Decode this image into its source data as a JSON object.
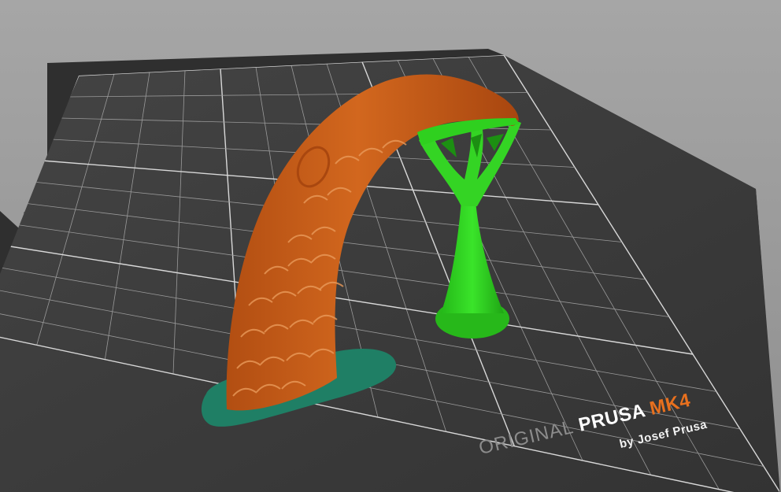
{
  "bed": {
    "logo_prefix": "ORIGINAL",
    "logo_brand": "PRUSA",
    "logo_model": "MK4",
    "logo_subtitle": "by Josef Prusa"
  },
  "colors": {
    "background": "#9e9e9e",
    "bed_surface": "#3a3a3a",
    "bed_frame": "#2f2f2f",
    "grid_line": "#cfcfcf",
    "model_body": "#c85a17",
    "model_brim": "#1f7f65",
    "support": "#2ed01e",
    "logo_accent": "#e8701e"
  },
  "objects": {
    "model": {
      "label": "curved-scaled-model-icon"
    },
    "support": {
      "label": "tree-support-icon"
    },
    "brim": {
      "label": "brim-icon"
    }
  }
}
